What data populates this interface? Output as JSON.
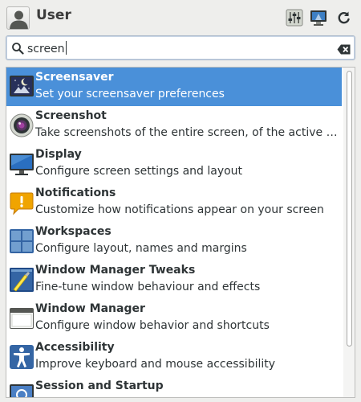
{
  "header": {
    "user_name": "User",
    "avatar_icon": "user-avatar-icon",
    "buttons": [
      {
        "icon": "settings-manager-icon"
      },
      {
        "icon": "display-preferences-icon"
      },
      {
        "icon": "logout-icon"
      }
    ]
  },
  "search": {
    "value": "screen",
    "icon": "search-icon",
    "clear_icon": "clear-icon"
  },
  "results": [
    {
      "title": "Screensaver",
      "description": "Set your screensaver preferences",
      "icon": "screensaver-icon",
      "selected": true
    },
    {
      "title": "Screenshot",
      "description": "Take screenshots of the entire screen, of the active window",
      "icon": "screenshot-icon",
      "selected": false
    },
    {
      "title": "Display",
      "description": "Configure screen settings and layout",
      "icon": "display-icon",
      "selected": false
    },
    {
      "title": "Notifications",
      "description": "Customize how notifications appear on your screen",
      "icon": "notifications-icon",
      "selected": false
    },
    {
      "title": "Workspaces",
      "description": "Configure layout, names and margins",
      "icon": "workspaces-icon",
      "selected": false
    },
    {
      "title": "Window Manager Tweaks",
      "description": "Fine-tune window behaviour and effects",
      "icon": "window-manager-tweaks-icon",
      "selected": false
    },
    {
      "title": "Window Manager",
      "description": "Configure window behavior and shortcuts",
      "icon": "window-manager-icon",
      "selected": false
    },
    {
      "title": "Accessibility",
      "description": "Improve keyboard and mouse accessibility",
      "icon": "accessibility-icon",
      "selected": false
    },
    {
      "title": "Session and Startup",
      "description": "",
      "icon": "session-startup-icon",
      "selected": false
    }
  ],
  "colors": {
    "selection": "#4a90d9",
    "window_background": "#eeeeec"
  }
}
